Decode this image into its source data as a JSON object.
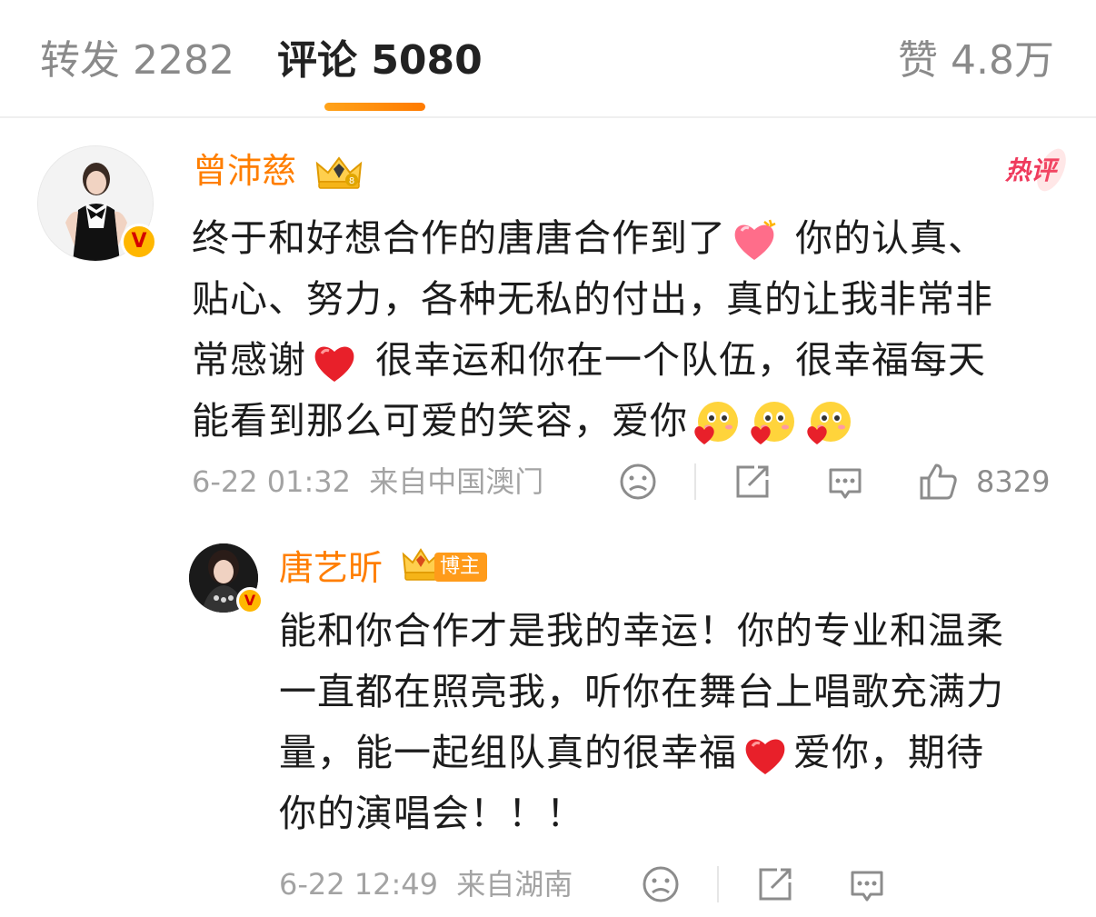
{
  "tabs": {
    "repost": "转发 2282",
    "comment": "评论 5080",
    "like": "赞 4.8万"
  },
  "comment": {
    "author": "曾沛慈",
    "hot_badge": "热评",
    "text_lines": [
      "终于和好想合作的唐唐合作到了",
      " 你的认真、",
      "贴心、努力，各种无私的付出，真的让我非常非",
      "常感谢",
      " 很幸运和你在一个队伍，很幸福每天",
      "能看到那么可爱的笑容，爱你"
    ],
    "time": "6-22 01:32",
    "location": "来自中国澳门",
    "like_count": "8329",
    "icons": [
      "sad-face-icon",
      "share-icon",
      "comment-icon",
      "thumbs-up-icon"
    ]
  },
  "reply": {
    "author": "唐艺昕",
    "blogger_badge": "博主",
    "text_lines": [
      "能和你合作才是我的幸运！你的专业和温柔",
      "一直都在照亮我，听你在舞台上唱歌充满力",
      "量，能一起组队真的很幸福",
      "爱你，期待",
      "你的演唱会！！！"
    ],
    "time": "6-22 12:49",
    "location": "来自湖南",
    "icons": [
      "sad-face-icon",
      "share-icon",
      "comment-icon"
    ]
  },
  "colors": {
    "accent": "#ff7e00",
    "indicator": "#ff8c00",
    "hot": "#ef3a5d",
    "vip_badge": "#ffb700",
    "heart": "#e8202a"
  },
  "badge_glyph": "V"
}
